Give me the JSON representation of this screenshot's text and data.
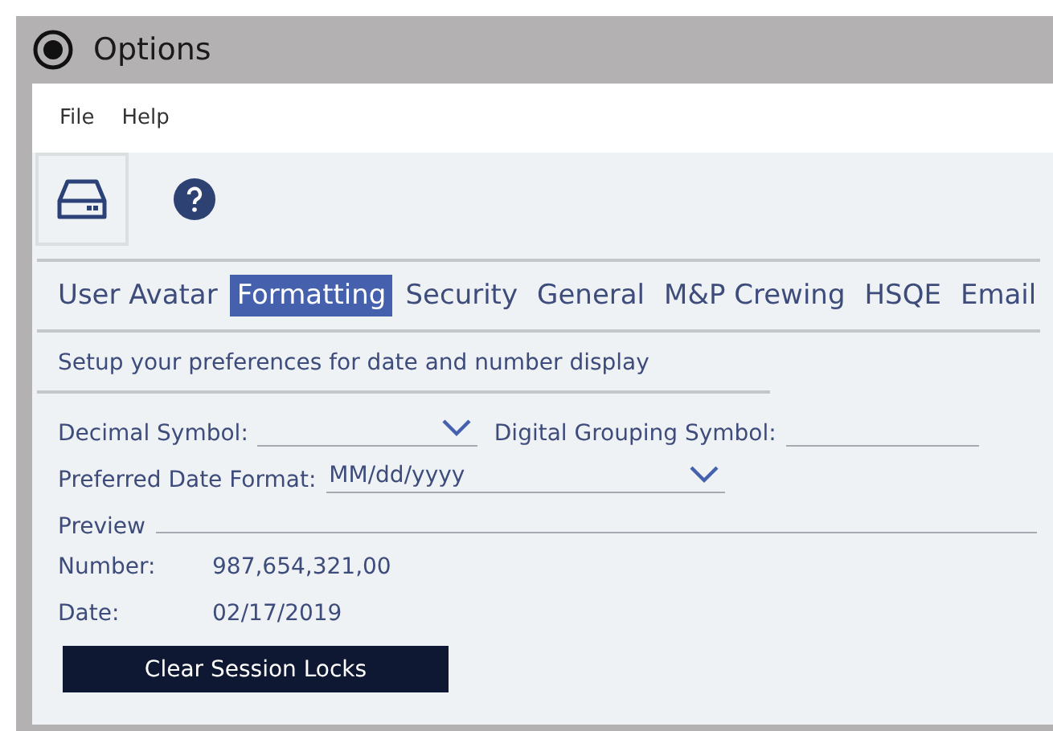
{
  "window": {
    "title": "Options"
  },
  "menu": [
    "File",
    "Help"
  ],
  "toolbar": [
    {
      "kind": "drive",
      "selected": true
    },
    {
      "kind": "help",
      "selected": false
    }
  ],
  "tabs": [
    {
      "label": "User Avatar",
      "selected": false
    },
    {
      "label": "Formatting",
      "selected": true
    },
    {
      "label": "Security",
      "selected": false
    },
    {
      "label": "General",
      "selected": false
    },
    {
      "label": "M&P Crewing",
      "selected": false
    },
    {
      "label": "HSQE",
      "selected": false
    },
    {
      "label": "Email",
      "selected": false
    }
  ],
  "description": "Setup your preferences for date and number display",
  "decimal_symbol": {
    "label": "Decimal Symbol:"
  },
  "grouping_symbol": {
    "label": "Digital Grouping Symbol:"
  },
  "date_format": {
    "label": "Preferred Date Format:",
    "value": "MM/dd/yyyy"
  },
  "preview": {
    "label": "Preview",
    "rows": [
      {
        "label": "Number:",
        "value": "987,654,321,00"
      },
      {
        "label": "Date:",
        "value": "02/17/2019"
      }
    ]
  },
  "button": "Clear Session Locks"
}
